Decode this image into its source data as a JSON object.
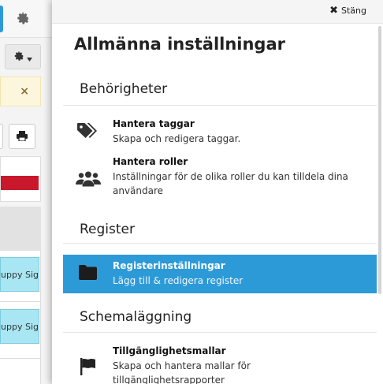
{
  "background": {
    "alert_close": "×",
    "rows": [
      {
        "label": "npuppy Sig"
      },
      {
        "label": "npuppy Sig"
      }
    ]
  },
  "panel": {
    "close_label": "Stäng",
    "title": "Allmänna inställningar",
    "sections": [
      {
        "title": "Behörigheter",
        "items": [
          {
            "title": "Hantera taggar",
            "desc": "Skapa och redigera taggar.",
            "icon": "tags-icon"
          },
          {
            "title": "Hantera roller",
            "desc": "Inställningar för de olika roller du kan tilldela dina användare",
            "icon": "users-icon"
          }
        ]
      },
      {
        "title": "Register",
        "items": [
          {
            "title": "Registerinställningar",
            "desc": "Lägg till & redigera register",
            "icon": "folder-icon",
            "active": true
          }
        ]
      },
      {
        "title": "Schemaläggning",
        "items": [
          {
            "title": "Tillgänglighetsmallar",
            "desc": "Skapa och hantera mallar för tillgänglighetsrapporter",
            "icon": "flag-icon"
          }
        ]
      }
    ]
  },
  "colors": {
    "accent": "#2d9ad8",
    "alert_bg": "#fcf6dc",
    "danger": "#c9182b",
    "row_bg": "#a9e6f3"
  }
}
